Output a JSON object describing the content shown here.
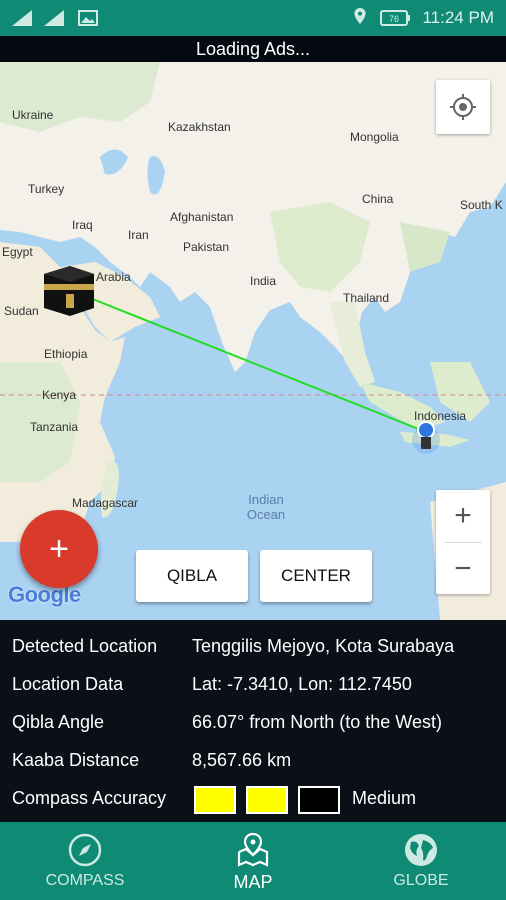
{
  "status_bar": {
    "time": "11:24 PM"
  },
  "ad_banner": {
    "text": "Loading Ads..."
  },
  "map": {
    "labels": {
      "ukraine": "Ukraine",
      "kazakhstan": "Kazakhstan",
      "mongolia": "Mongolia",
      "turkey": "Turkey",
      "china": "China",
      "south_korea": "South K",
      "iraq": "Iraq",
      "afghanistan": "Afghanistan",
      "iran": "Iran",
      "pakistan": "Pakistan",
      "egypt": "Egypt",
      "saudi_arabia": "Arabia",
      "india": "India",
      "thailand": "Thailand",
      "sudan": "Sudan",
      "ethiopia": "Ethiopia",
      "kenya": "Kenya",
      "indonesia": "Indonesia",
      "tanzania": "Tanzania",
      "madagascar": "Madagascar",
      "indian_ocean": "Indian Ocean"
    },
    "google_logo": "Google",
    "zoom_in": "+",
    "zoom_out": "−",
    "fab_label": "+",
    "qibla_button": "QIBLA",
    "center_button": "CENTER"
  },
  "info": {
    "detected_location_label": "Detected Location",
    "detected_location_value": "Tenggilis Mejoyo, Kota Surabaya",
    "location_data_label": "Location Data",
    "location_data_value": "Lat: -7.3410, Lon: 112.7450",
    "qibla_angle_label": "Qibla Angle",
    "qibla_angle_value": "66.07° from North (to the West)",
    "kaaba_distance_label": "Kaaba Distance",
    "kaaba_distance_value": "8,567.66 km",
    "compass_accuracy_label": "Compass Accuracy",
    "compass_accuracy_value": "Medium",
    "accuracy_colors": [
      "#ffff00",
      "#ffff00",
      "#000000"
    ]
  },
  "bottom_nav": {
    "compass": "COMPASS",
    "map": "MAP",
    "globe": "GLOBE"
  },
  "colors": {
    "accent": "#0f8a75",
    "fab": "#d93a2b",
    "qibla_line": "#22dd22"
  }
}
